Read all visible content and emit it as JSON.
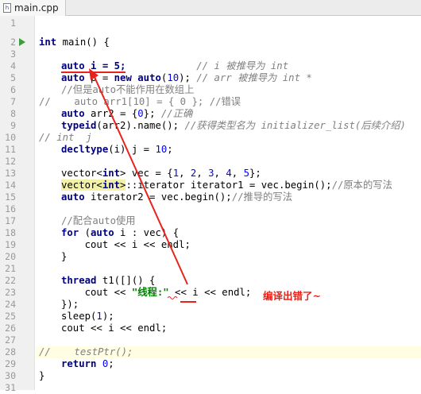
{
  "tab": {
    "file_name": "main.cpp",
    "icon_text": "h"
  },
  "lines": [
    "1",
    "2",
    "3",
    "4",
    "5",
    "6",
    "7",
    "8",
    "9",
    "10",
    "11",
    "12",
    "13",
    "14",
    "15",
    "16",
    "17",
    "18",
    "19",
    "20",
    "21",
    "22",
    "23",
    "24",
    "25",
    "26",
    "27",
    "28",
    "29",
    "30",
    "31"
  ],
  "code": {
    "l2_kw": "int",
    "l2_rest": " main() {",
    "l4_a": "auto i = 5;",
    "l4_pad": "            ",
    "l4_c": "// i 被推导为 int",
    "l5_kw1": "auto",
    "l5_b": " p = ",
    "l5_kw2": "new",
    "l5_sp": " ",
    "l5_kw3": "auto",
    "l5_c": "(",
    "l5_n": "10",
    "l5_d": "); ",
    "l5_cmt": "// arr 被推导为 int *",
    "l6": "//但是auto不能作用在数组上",
    "l7": "//    auto arr1[10] = { 0 }; //错误",
    "l8_kw": "auto",
    "l8_rest": " arr2 = {",
    "l8_n": "0",
    "l8_end": "}; ",
    "l8_cmt": "//正确",
    "l9_kw": "typeid",
    "l9_rest": "(arr2).name(); ",
    "l9_cmt": "//获得类型名为 initializer_list(后续介绍)",
    "l10": "// int  j",
    "l11_kw": "decltype",
    "l11_rest": "(i) j = ",
    "l11_n": "10",
    "l11_end": ";",
    "l13_a": "vector",
    "l13_b": "<",
    "l13_kw": "int",
    "l13_c": ">",
    "l13_rest": " vec = {",
    "l13_n1": "1",
    "l13_s": ", ",
    "l13_n2": "2",
    "l13_n3": "3",
    "l13_n4": "4",
    "l13_n5": "5",
    "l13_end": "};",
    "l14_a": "vector",
    "l14_b": "<",
    "l14_kw": "int",
    "l14_c": ">",
    "l14_rest": "::iterator iterator1 = vec.begin();",
    "l14_cmt": "//原本的写法",
    "l15_kw": "auto",
    "l15_rest": " iterator2 = vec.begin();",
    "l15_cmt": "//推导的写法",
    "l17": "//配合auto使用",
    "l18_kw1": "for",
    "l18_a": " (",
    "l18_kw2": "auto",
    "l18_b": " i : vec) {",
    "l19": "    cout << i << endl;",
    "l20": "}",
    "l22_kw": "thread",
    "l22_rest": " t1([]() {",
    "l23_a": "    cout << ",
    "l23_str": "\"线程:\"",
    "l23_b": " << i << endl;",
    "l24": "});",
    "l25_a": "sleep(",
    "l25_n": "1",
    "l25_b": ");",
    "l26": "cout << i << endl;",
    "l28": "//    testPtr();",
    "l29_kw": "return",
    "l29_sp": " ",
    "l29_n": "0",
    "l29_end": ";",
    "l30": "}"
  },
  "annotation": "编译出错了~",
  "colors": {
    "annotation": "#f01e14",
    "keyword": "#000080",
    "number": "#0000ff",
    "string": "#008000",
    "comment": "#808080"
  }
}
